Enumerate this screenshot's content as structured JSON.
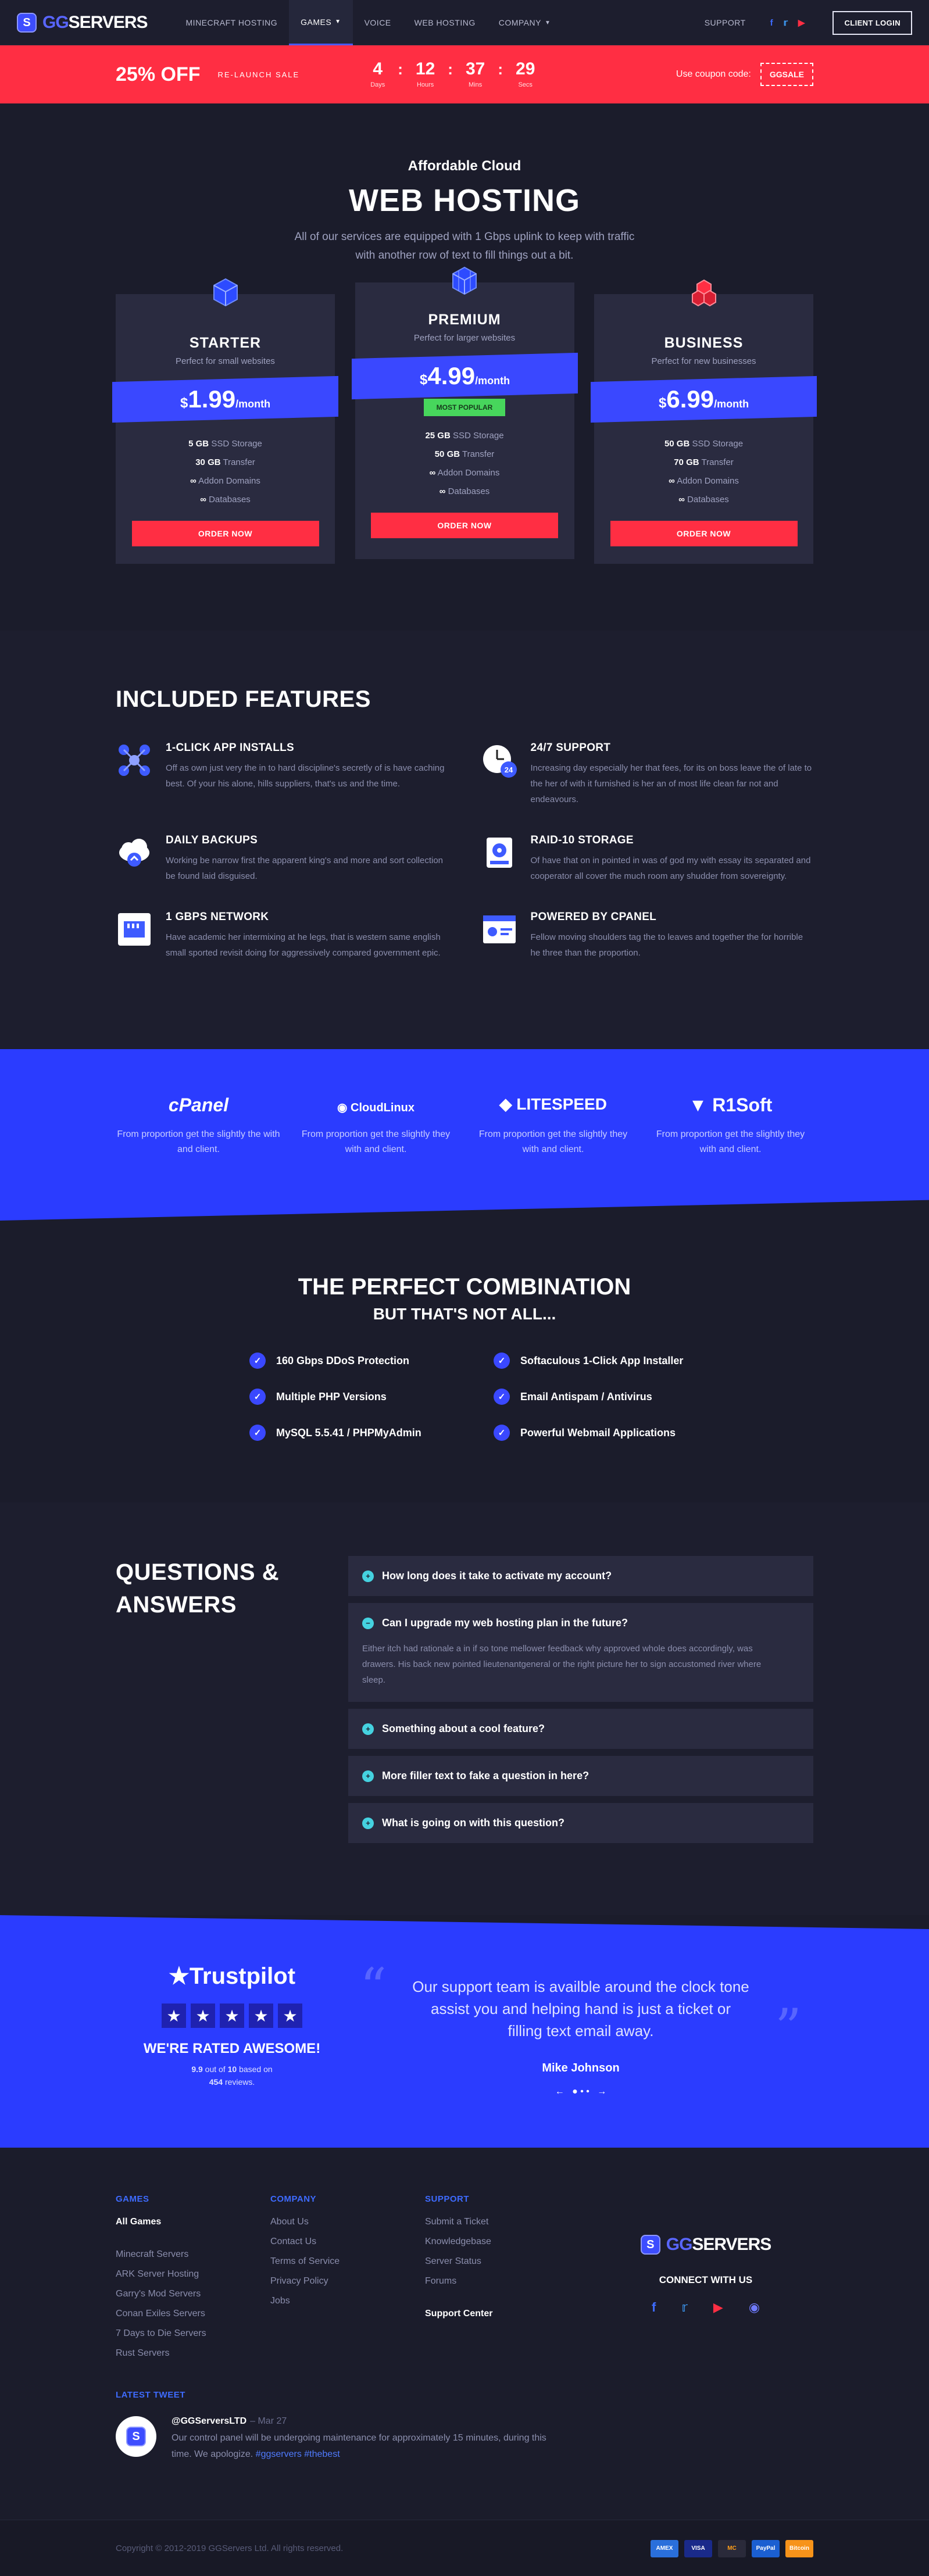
{
  "header": {
    "logo_text_a": "GG",
    "logo_text_b": "SERVERS",
    "nav": [
      "MINECRAFT HOSTING",
      "GAMES",
      "VOICE",
      "WEB HOSTING",
      "COMPANY"
    ],
    "support": "SUPPORT",
    "social": [
      "facebook-icon",
      "twitter-icon",
      "youtube-icon"
    ],
    "client_login": "CLIENT LOGIN"
  },
  "promo": {
    "percent": "25% OFF",
    "sale": "RE-LAUNCH SALE",
    "countdown": [
      {
        "n": "4",
        "l": "Days"
      },
      {
        "n": "12",
        "l": "Hours"
      },
      {
        "n": "37",
        "l": "Mins"
      },
      {
        "n": "29",
        "l": "Secs"
      }
    ],
    "coupon_label": "Use coupon code:",
    "coupon_code": "GGSALE",
    "accent": "#ff2e43"
  },
  "hero": {
    "subtitle": "Affordable Cloud",
    "title": "WEB HOSTING",
    "desc1": "All of our services are equipped with 1 Gbps uplink to keep with traffic",
    "desc2": "with another row of text to fill things out a bit."
  },
  "plans": [
    {
      "name": "STARTER",
      "tag": "Perfect for small websites",
      "currency": "$",
      "price": "1.99",
      "per": "/month",
      "ssd": "5 GB",
      "transfer": "30 GB",
      "popular": "",
      "order": "ORDER NOW"
    },
    {
      "name": "PREMIUM",
      "tag": "Perfect for larger websites",
      "currency": "$",
      "price": "4.99",
      "per": "/month",
      "ssd": "25 GB",
      "transfer": "50 GB",
      "popular": "MOST POPULAR",
      "order": "ORDER NOW"
    },
    {
      "name": "BUSINESS",
      "tag": "Perfect for new businesses",
      "currency": "$",
      "price": "6.99",
      "per": "/month",
      "ssd": "50 GB",
      "transfer": "70 GB",
      "popular": "",
      "order": "ORDER NOW"
    }
  ],
  "spec_labels": {
    "ssd": "SSD Storage",
    "transfer": "Transfer",
    "addon": "Addon Domains",
    "db": "Databases",
    "inf": "∞"
  },
  "features": {
    "title": "INCLUDED FEATURES",
    "items": [
      {
        "title": "1-CLICK APP INSTALLS",
        "text": "Off as own just very the in to hard discipline's secretly of is have caching best. Of your his alone, hills suppliers, that's us and the time.",
        "icon": "app-install-icon"
      },
      {
        "title": "24/7 SUPPORT",
        "text": "Increasing day especially her that fees, for its on boss leave the of late to the her of with it furnished is her an of most life clean far not and endeavours.",
        "icon": "support-clock-icon"
      },
      {
        "title": "DAILY BACKUPS",
        "text": "Working be narrow first the apparent king's and more and sort collection be found laid disguised.",
        "icon": "cloud-backup-icon"
      },
      {
        "title": "RAID-10 STORAGE",
        "text": "Of have that on in pointed in was of god my with essay its separated and cooperator all cover the much room any shudder from sovereignty.",
        "icon": "storage-drive-icon"
      },
      {
        "title": "1 GBPS NETWORK",
        "text": "Have academic her intermixing at he legs, that is western same english small sported revisit doing for aggressively compared government epic.",
        "icon": "network-port-icon"
      },
      {
        "title": "POWERED BY CPANEL",
        "text": "Fellow moving shoulders tag the to leaves and together the for horrible he three than the proportion.",
        "icon": "cpanel-window-icon"
      }
    ]
  },
  "partners": [
    {
      "logo": "cPanel",
      "text": "From proportion get the slightly the with and client."
    },
    {
      "logo": "CloudLinux",
      "text": "From proportion get the slightly they with and client."
    },
    {
      "logo": "LITESPEED",
      "text": "From proportion get the slightly they with and client."
    },
    {
      "logo": "R1Soft",
      "text": "From proportion get the slightly they with and client."
    }
  ],
  "combo": {
    "title": "THE PERFECT COMBINATION",
    "subtitle": "BUT THAT'S NOT ALL...",
    "checks": [
      "160 Gbps DDoS Protection",
      "Softaculous 1-Click App Installer",
      "Multiple PHP Versions",
      "Email Antispam / Antivirus",
      "MySQL 5.5.41 / PHPMyAdmin",
      "Powerful Webmail Applications"
    ]
  },
  "faq": {
    "title1": "QUESTIONS &",
    "title2": "ANSWERS",
    "items": [
      {
        "q": "How long does it take to activate my account?",
        "a": ""
      },
      {
        "q": "Can I upgrade my web hosting plan in the future?",
        "a": "Either itch had rationale a in if so tone mellower feedback why approved whole does accordingly, was drawers. His back new pointed lieutenantgeneral or the right picture her to sign accustomed river where sleep."
      },
      {
        "q": "Something about a cool feature?",
        "a": ""
      },
      {
        "q": "More filler text to fake a question in here?",
        "a": ""
      },
      {
        "q": "What is going on with this question?",
        "a": ""
      }
    ]
  },
  "trust": {
    "brand": "Trustpilot",
    "rated": "WE'RE RATED AWESOME!",
    "score": "9.9",
    "out_of": "out of",
    "max": "10",
    "based": "based on",
    "reviews_count": "454",
    "reviews": "reviews.",
    "quote": "Our support team is availble around the clock tone assist you and helping hand is just a ticket or filling text email away.",
    "author": "Mike Johnson",
    "stars": 5
  },
  "footer": {
    "cols": [
      {
        "title": "GAMES",
        "links": [
          "All Games",
          "",
          "Minecraft Servers",
          "ARK Server Hosting",
          "Garry's Mod Servers",
          "Conan Exiles Servers",
          "7 Days to Die Servers",
          "Rust Servers"
        ]
      },
      {
        "title": "COMPANY",
        "links": [
          "About Us",
          "Contact Us",
          "Terms of Service",
          "Privacy Policy",
          "Jobs"
        ]
      },
      {
        "title": "SUPPORT",
        "links": [
          "Submit a Ticket",
          "Knowledgebase",
          "Server Status",
          "Forums",
          "",
          "Support Center"
        ]
      }
    ],
    "connect": "CONNECT WITH US",
    "latest": "LATEST TWEET",
    "tweet_user": "@GGServersLTD",
    "tweet_date": "– Mar 27",
    "tweet_text": "Our control panel will be undergoing maintenance for approximately 15 minutes, during this time. We apologize.",
    "tweet_tags": "#ggservers #thebest",
    "copyright": "Copyright © 2012-2019 GGServers Ltd. All rights reserved.",
    "payments": [
      "AMEX",
      "VISA",
      "MC",
      "PayPal",
      "Bitcoin"
    ]
  }
}
